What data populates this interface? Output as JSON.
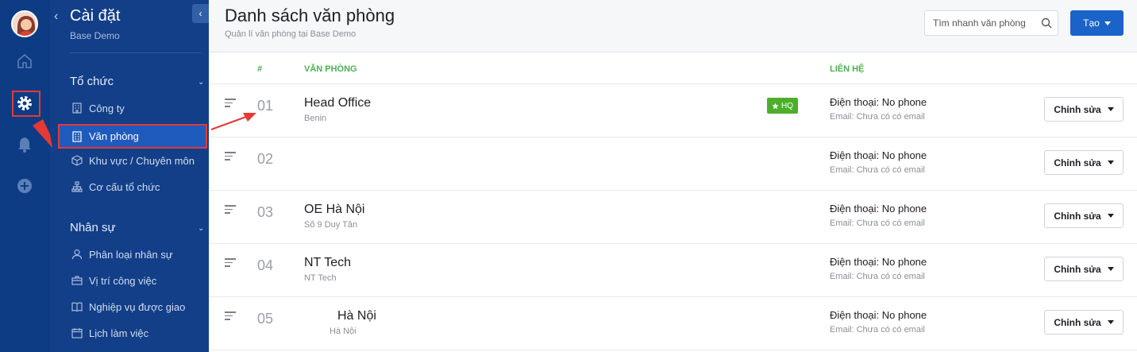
{
  "colors": {
    "rail": "#0d3c84",
    "nav": "#123f87",
    "accent": "#1a63c9",
    "hq": "#4caf2c",
    "annotation": "#e53935"
  },
  "rail": {
    "icons": [
      "home-icon",
      "gear-icon",
      "bell-icon",
      "plus-circle-icon"
    ]
  },
  "nav": {
    "title": "Cài đặt",
    "subtitle": "Base Demo",
    "sections": [
      {
        "label": "Tổ chức",
        "items": [
          {
            "label": "Công ty",
            "icon": "building-icon"
          },
          {
            "label": "Văn phòng",
            "icon": "office-icon",
            "active": true
          },
          {
            "label": "Khu vực / Chuyên môn",
            "icon": "cube-icon"
          },
          {
            "label": "Cơ cấu tổ chức",
            "icon": "org-chart-icon"
          }
        ]
      },
      {
        "label": "Nhân sự",
        "items": [
          {
            "label": "Phân loại nhân sự",
            "icon": "user-icon"
          },
          {
            "label": "Vị trí công việc",
            "icon": "briefcase-icon"
          },
          {
            "label": "Nghiệp vụ được giao",
            "icon": "book-icon"
          },
          {
            "label": "Lịch làm việc",
            "icon": "calendar-icon"
          }
        ]
      }
    ]
  },
  "header": {
    "title": "Danh sách văn phòng",
    "subtitle": "Quản lí văn phòng tại Base Demo",
    "search_placeholder": "Tìm nhanh văn phòng",
    "create_label": "Tạo"
  },
  "table": {
    "columns": {
      "num": "#",
      "office": "VĂN PHÒNG",
      "contact": "LIÊN HỆ"
    },
    "edit_label": "Chỉnh sửa",
    "hq_label": "HQ",
    "rows": [
      {
        "num": "01",
        "name": "Head Office",
        "address": "Benin",
        "hq": true,
        "phone": "Điện thoại: No phone",
        "email": "Email: Chưa có có email"
      },
      {
        "num": "02",
        "name": "",
        "address": "",
        "hq": false,
        "phone": "Điện thoại: No phone",
        "email": "Email: Chưa có có email"
      },
      {
        "num": "03",
        "name": "OE Hà Nội",
        "address": "Số 9 Duy Tân",
        "hq": false,
        "phone": "Điện thoại: No phone",
        "email": "Email: Chưa có có email"
      },
      {
        "num": "04",
        "name": "NT Tech",
        "address": "NT Tech",
        "hq": false,
        "phone": "Điện thoại: No phone",
        "email": "Email: Chưa có có email"
      },
      {
        "num": "05",
        "name": "Hà Nội",
        "address": "Hà Nội",
        "hq": false,
        "indent": true,
        "phone": "Điện thoại: No phone",
        "email": "Email: Chưa có có email"
      }
    ]
  }
}
